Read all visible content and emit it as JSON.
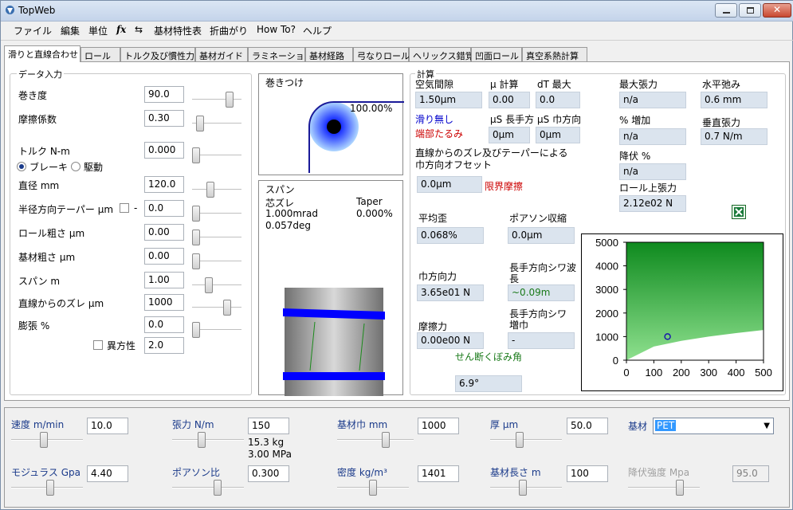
{
  "window": {
    "title": "TopWeb"
  },
  "menu": [
    "ファイル",
    "編集",
    "単位",
    "fx",
    "⇆",
    "基材特性表",
    "折曲がり",
    "How To?",
    "ヘルプ"
  ],
  "tabs": [
    "滑りと直線合わせ",
    "ロール",
    "トルク及び慣性力",
    "基材ガイド",
    "ラミネーション",
    "基材経路",
    "弓なりロール",
    "ヘリックス錯覚",
    "凹面ロール",
    "真空系熱計算"
  ],
  "data_input": {
    "group_label": "データ入力",
    "wrap": {
      "label": "巻き度",
      "value": "90.0",
      "slider": 0.8
    },
    "friction": {
      "label": "摩擦係数",
      "value": "0.30",
      "slider": 0.1
    },
    "torque": {
      "label": "トルク N-m",
      "value": "0.000",
      "slider": 0.0
    },
    "brake_label": "ブレーキ",
    "drive_label": "駆動",
    "diameter": {
      "label": "直径 mm",
      "value": "120.0",
      "slider": 0.35
    },
    "taper": {
      "label": "半径方向テーパー μm",
      "dash": "-",
      "value": "0.0",
      "slider": 0.0
    },
    "roll_rough": {
      "label": "ロール粗さ μm",
      "value": "0.00",
      "slider": 0.0
    },
    "web_rough": {
      "label": "基材粗さ μm",
      "value": "0.00",
      "slider": 0.0
    },
    "span": {
      "label": "スパン m",
      "value": "1.00",
      "slider": 0.3
    },
    "misalign": {
      "label": "直線からのズレ μm",
      "value": "1000",
      "slider": 0.75
    },
    "expansion": {
      "label": "膨張 %",
      "value": "0.0",
      "slider": 0.0
    },
    "anisotropy": {
      "label": "異方性",
      "value": "2.0"
    }
  },
  "wrap_view": {
    "label": "巻きつけ",
    "percent": "100.00%"
  },
  "span_view": {
    "label": "スパン",
    "misalign_title": "芯ズレ",
    "misalign_mrad": "1.000mrad",
    "misalign_deg": "0.057deg",
    "taper_title": "Taper",
    "taper_value": "0.000%"
  },
  "calc": {
    "group_label": "計算",
    "air_gap": {
      "label": "空気間隙",
      "value": "1.50μm"
    },
    "mu_calc": {
      "label": "μ 計算",
      "value": "0.00"
    },
    "dt_max": {
      "label": "dT 最大",
      "value": "0.0"
    },
    "no_slip": "滑り無し",
    "edge_slack": "端部たるみ",
    "us_md": {
      "label": "μS 長手方",
      "value": "0μm"
    },
    "us_cd": {
      "label": "μS 巾方向",
      "value": "0μm"
    },
    "offset_label_1": "直線からのズレ及びテーパーによる",
    "offset_label_2": "巾方向オフセット",
    "offset_value": "0.0μm",
    "limit_friction": "限界摩擦",
    "avg_strain": {
      "label": "平均歪",
      "value": "0.068%"
    },
    "poisson_shrink": {
      "label": "ポアソン収縮",
      "value": "0.0μm"
    },
    "cd_force": {
      "label": "巾方向力",
      "value": "3.65e01 N"
    },
    "wrinkle_wave_1": "長手方向シワ波",
    "wrinkle_wave_2": "長",
    "wrinkle_wave_value": "~0.09m",
    "friction_force": {
      "label": "摩擦力",
      "value": "0.00e00 N"
    },
    "wrinkle_width_1": "長手方向シワ",
    "wrinkle_width_2": "増巾",
    "wrinkle_width_value": "-",
    "shear_angle": {
      "label": "せん断くぼみ角",
      "value": "6.9°"
    },
    "max_tension": {
      "label": "最大張力",
      "value": "n/a"
    },
    "pct_increase": {
      "label": "% 増加",
      "value": "n/a"
    },
    "yield_pct": {
      "label": "降伏 %",
      "value": "n/a"
    },
    "roll_tension": {
      "label": "ロール上張力",
      "value": "2.12e02 N"
    },
    "h_slack": {
      "label": "水平弛み",
      "value": "0.6 mm"
    },
    "v_tension": {
      "label": "垂直張力",
      "value": "0.7 N/m"
    },
    "excel_icon": "excel-icon"
  },
  "chart_data": {
    "type": "area",
    "x_ticks": [
      "0",
      "100",
      "200",
      "300",
      "400",
      "500"
    ],
    "y_ticks": [
      "0",
      "1000",
      "2000",
      "3000",
      "4000",
      "5000"
    ],
    "xlim": [
      0,
      500
    ],
    "ylim": [
      0,
      5000
    ],
    "boundary": {
      "x": [
        0,
        100,
        200,
        300,
        400,
        500
      ],
      "y": [
        0,
        580,
        820,
        1000,
        1150,
        1280
      ]
    },
    "point": {
      "x": 150,
      "y": 1000
    },
    "fill_color": "#22aa22"
  },
  "bottom": {
    "speed": {
      "label": "速度 m/min",
      "value": "10.0",
      "slider": 0.45
    },
    "tension": {
      "label": "張力 N/m",
      "value": "150",
      "sub1": "15.3 kg",
      "sub2": "3.00 MPa",
      "slider": 0.4
    },
    "width": {
      "label": "基材巾 mm",
      "value": "1000",
      "slider": 0.65
    },
    "thickness": {
      "label": "厚 μm",
      "value": "50.0",
      "slider": 0.4
    },
    "material": {
      "label": "基材",
      "value": "PET"
    },
    "modulus": {
      "label": "モジュラス Gpa",
      "value": "4.40",
      "slider": 0.55
    },
    "poisson": {
      "label": "ポアソン比",
      "value": "0.300",
      "slider": 0.65
    },
    "density": {
      "label": "密度 kg/m³",
      "value": "1401",
      "slider": 0.5
    },
    "length": {
      "label": "基材長さ m",
      "value": "100",
      "slider": 0.45
    },
    "yield_strength": {
      "label": "降伏強度 Mpa",
      "value": "95.0",
      "slider": 0.75
    }
  },
  "colors": {
    "accent": "#1a3a8a",
    "roller": "#0000ff",
    "warn": "#cc0000"
  }
}
